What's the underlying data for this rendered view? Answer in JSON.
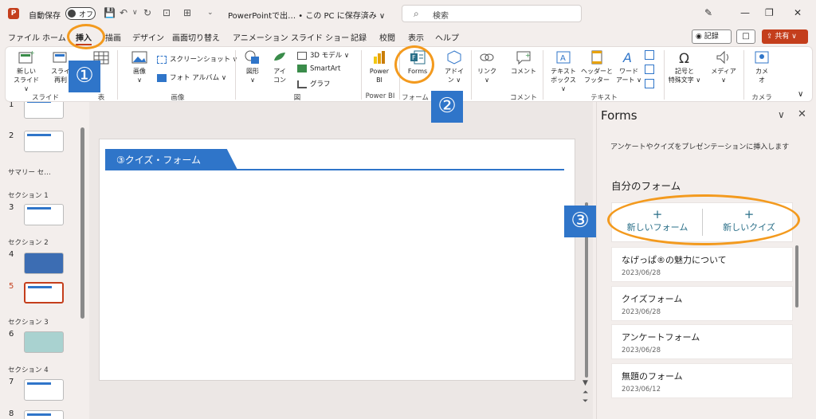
{
  "titlebar": {
    "logo": "P",
    "autosave_label": "自動保存",
    "toggle_state": "オフ",
    "doc_title": "PowerPointで出…  • この PC に保存済み ∨",
    "search_placeholder": "検索"
  },
  "tabs": [
    "ファイル",
    "ホーム",
    "挿入",
    "描画",
    "デザイン",
    "画面切り替え",
    "アニメーション",
    "スライド ショー",
    "記録",
    "校閲",
    "表示",
    "ヘルプ"
  ],
  "actions": {
    "record": "◉ 記録",
    "comment": "□",
    "share": "⇪ 共有 ∨"
  },
  "ribbon": {
    "new_slide": "新しい\nスライド ∨",
    "reuse": "スライ\n再利",
    "table": "表",
    "image": "画像\n∨",
    "screenshot": "スクリーンショット ∨",
    "photo_album": "フォト アルバム ∨",
    "shapes": "図形\n∨",
    "icons": "アイ\nコン",
    "model3d": "3D モデル ∨",
    "smartart": "SmartArt",
    "graph": "グラフ",
    "powerbi": "Power\nBI",
    "forms": "Forms",
    "addins": "アドイ\nン ∨",
    "link": "リンク\n∨",
    "comment": "コメント",
    "textbox": "テキスト\nボックス ∨",
    "header_footer": "ヘッダーと\nフッター",
    "wordart": "ワード\nアート ∨",
    "symbols": "記号と\n特殊文字 ∨",
    "media": "メディア\n∨",
    "camera": "カメ\nオ",
    "groups": {
      "slides": "スライド",
      "table": "表",
      "images": "画像",
      "figures": "図",
      "powerbi": "Power BI",
      "forms": "フォーム",
      "comment": "コメント",
      "text": "テキスト",
      "camera": "カメラ"
    }
  },
  "thumbnails": {
    "numbers": [
      "1",
      "2",
      "3",
      "4",
      "5",
      "6",
      "7",
      "8"
    ],
    "sections": [
      "サマリー セ…",
      "セクション 1",
      "セクション 2",
      "セクション 3",
      "セクション 4"
    ]
  },
  "slide": {
    "title": "③クイズ・フォーム"
  },
  "forms_pane": {
    "title": "Forms",
    "description": "アンケートやクイズをプレゼンテーションに挿入します",
    "my_forms": "自分のフォーム",
    "new_form": "新しいフォーム",
    "new_quiz": "新しいクイズ",
    "items": [
      {
        "name": "なげっぱ®の魅力について",
        "date": "2023/06/28"
      },
      {
        "name": "クイズフォーム",
        "date": "2023/06/28"
      },
      {
        "name": "アンケートフォーム",
        "date": "2023/06/28"
      },
      {
        "name": "無題のフォーム",
        "date": "2023/06/12"
      }
    ]
  },
  "annotations": {
    "one": "①",
    "two": "②",
    "three": "③"
  },
  "colors": {
    "accent": "#c43e1c",
    "highlight": "#f39a1e",
    "badge": "#2f75c9"
  }
}
